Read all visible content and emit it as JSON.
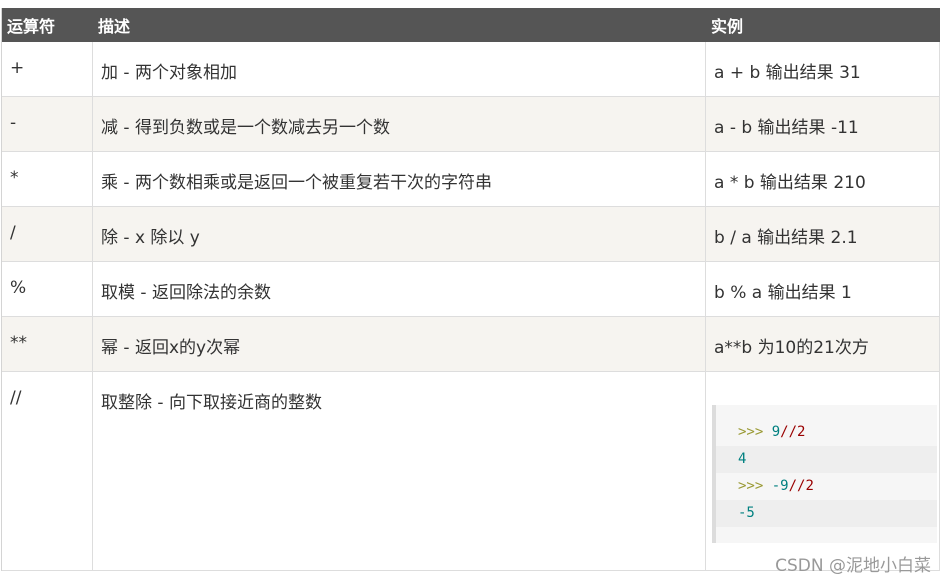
{
  "table": {
    "headers": [
      "运算符",
      "描述",
      "实例"
    ],
    "rows": [
      {
        "op": "+",
        "desc": "加 - 两个对象相加",
        "example": "a + b 输出结果 31"
      },
      {
        "op": "-",
        "desc": "减 - 得到负数或是一个数减去另一个数",
        "example": "a - b 输出结果 -11"
      },
      {
        "op": "*",
        "desc": "乘 - 两个数相乘或是返回一个被重复若干次的字符串",
        "example": "a * b 输出结果 210"
      },
      {
        "op": "/",
        "desc": "除 - x 除以 y",
        "example": "b / a 输出结果 2.1"
      },
      {
        "op": "%",
        "desc": "取模 - 返回除法的余数",
        "example": "b % a 输出结果 1"
      },
      {
        "op": "**",
        "desc": "幂 - 返回x的y次幂",
        "example": "a**b 为10的21次方"
      },
      {
        "op": "//",
        "desc": "取整除 - 向下取接近商的整数",
        "example": ""
      }
    ]
  },
  "code": {
    "line1": {
      "prompt": ">>>",
      "num": "9",
      "op": "//",
      "num2": "2"
    },
    "line2": {
      "out": "4"
    },
    "line3": {
      "prompt": ">>>",
      "num": "-9",
      "op": "//",
      "num2": "2"
    },
    "line4": {
      "out": "-5"
    }
  },
  "watermark": "CSDN @泥地小白菜",
  "colors": {
    "header_bg": "#555555",
    "row_even_bg": "#f6f4f0",
    "code_bg": "#f6f6f6"
  }
}
